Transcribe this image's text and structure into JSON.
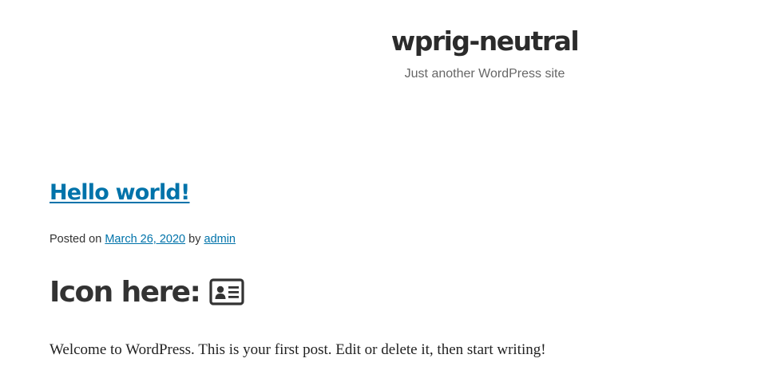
{
  "header": {
    "site_title": "wprig-neutral",
    "site_description": "Just another WordPress site"
  },
  "post": {
    "title": "Hello world!",
    "meta": {
      "posted_on_label": "Posted on",
      "date": "March 26, 2020",
      "by_label": "by",
      "author": "admin"
    },
    "content_heading": "Icon here:",
    "content_icon": "id-card-icon",
    "content_paragraph": "Welcome to WordPress. This is your first post. Edit or delete it, then start writing!"
  },
  "colors": {
    "link": "#0073aa",
    "text": "#333333",
    "description": "#666666"
  }
}
